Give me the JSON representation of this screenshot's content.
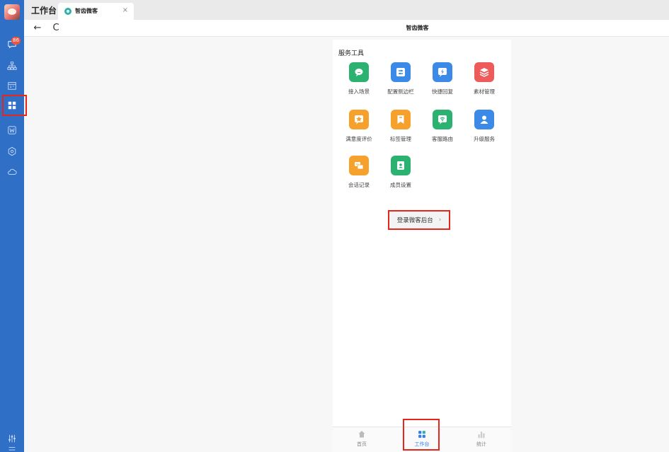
{
  "app": {
    "title": "工作台"
  },
  "tab": {
    "label": "智齿微客",
    "close": "×"
  },
  "nav": {
    "back": "←",
    "refresh": "C",
    "title": "智齿微客"
  },
  "sidebar": {
    "badge": "86",
    "icons": [
      "chat-icon",
      "org-chart-icon",
      "calendar-icon",
      "workbench-grid-icon",
      "word-icon",
      "hexagon-icon",
      "cloud-icon",
      "settings-sliders-icon",
      "menu-icon"
    ]
  },
  "section": {
    "title": "服务工具"
  },
  "tools": [
    {
      "label": "接入场景",
      "color": "#2cb270",
      "icon": "chat-bubble-icon"
    },
    {
      "label": "配置侧边栏",
      "color": "#3b8ae8",
      "icon": "sliders-icon"
    },
    {
      "label": "快捷回复",
      "color": "#3b8ae8",
      "icon": "lightning-icon"
    },
    {
      "label": "素材管理",
      "color": "#ee5b5b",
      "icon": "layers-icon"
    },
    {
      "label": "满意度评价",
      "color": "#f5a12b",
      "icon": "star-icon"
    },
    {
      "label": "标签管理",
      "color": "#f5a12b",
      "icon": "bookmark-icon"
    },
    {
      "label": "客服路由",
      "color": "#2cb270",
      "icon": "wifi-icon"
    },
    {
      "label": "升级服务",
      "color": "#3b8ae8",
      "icon": "user-icon"
    },
    {
      "label": "会话记录",
      "color": "#f5a12b",
      "icon": "conversation-icon"
    },
    {
      "label": "成员设置",
      "color": "#2cb270",
      "icon": "contacts-icon"
    }
  ],
  "login": {
    "label": "登录微客后台",
    "chevron": "›"
  },
  "bottom_tabs": [
    {
      "label": "首页",
      "icon": "home-icon",
      "active": false
    },
    {
      "label": "工作台",
      "icon": "workbench-icon",
      "active": true
    },
    {
      "label": "统计",
      "icon": "bar-chart-icon",
      "active": false
    }
  ]
}
